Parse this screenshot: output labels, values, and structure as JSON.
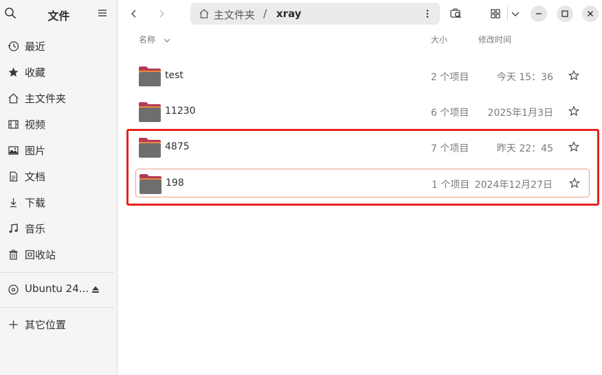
{
  "sidebar": {
    "title": "文件",
    "items": [
      {
        "label": "最近",
        "icon": "recent-icon"
      },
      {
        "label": "收藏",
        "icon": "star-icon"
      },
      {
        "label": "主文件夹",
        "icon": "home-icon"
      },
      {
        "label": "视频",
        "icon": "video-icon"
      },
      {
        "label": "图片",
        "icon": "image-icon"
      },
      {
        "label": "文档",
        "icon": "document-icon"
      },
      {
        "label": "下载",
        "icon": "download-icon"
      },
      {
        "label": "音乐",
        "icon": "music-icon"
      },
      {
        "label": "回收站",
        "icon": "trash-icon"
      }
    ],
    "drive": {
      "label": "Ubuntu 24...",
      "icon": "disc-icon"
    },
    "other": {
      "label": "其它位置",
      "icon": "plus-icon"
    }
  },
  "pathbar": {
    "home": "主文件夹",
    "separator": "/",
    "current": "xray"
  },
  "columns": {
    "name": "名称",
    "size": "大小",
    "modified": "修改时间"
  },
  "files": [
    {
      "name": "test",
      "size": "2 个项目",
      "modified": "今天 15：36"
    },
    {
      "name": "11230",
      "size": "6 个项目",
      "modified": "2025年1月3日"
    },
    {
      "name": "4875",
      "size": "7 个项目",
      "modified": "昨天 22：45"
    },
    {
      "name": "198",
      "size": "1 个项目",
      "modified": "2024年12月27日"
    }
  ],
  "colors": {
    "accent": "#e95420",
    "highlight_box": "#e8201c",
    "folder_top": "#b53a55",
    "folder_body": "#6e6e6e"
  }
}
